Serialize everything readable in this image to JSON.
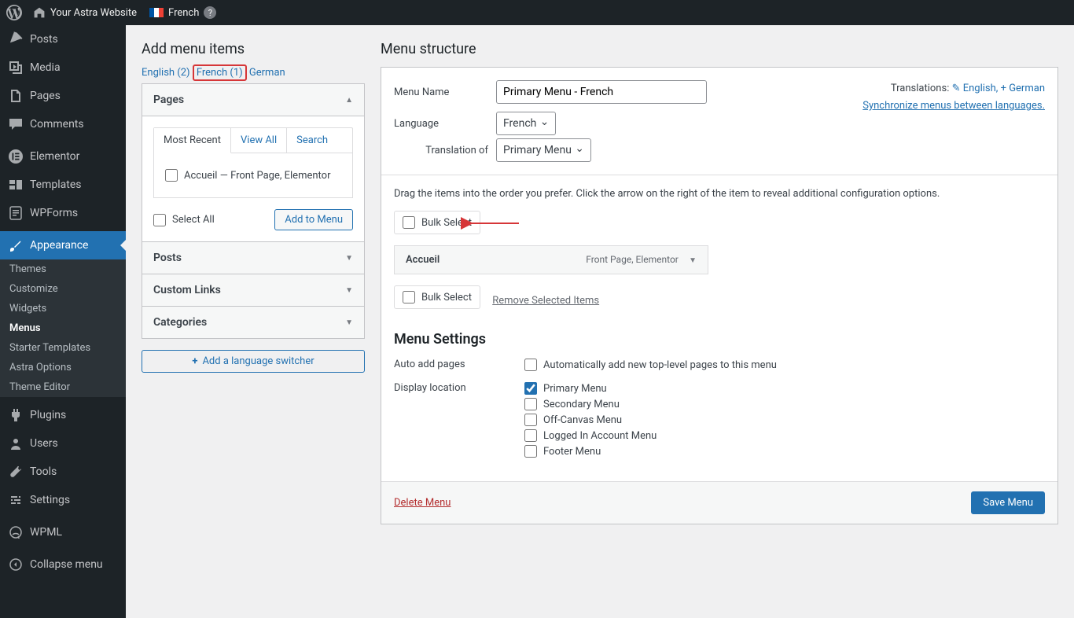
{
  "topbar": {
    "site": "Your Astra Website",
    "lang": "French"
  },
  "sidebar": {
    "items": [
      {
        "label": "Posts"
      },
      {
        "label": "Media"
      },
      {
        "label": "Pages"
      },
      {
        "label": "Comments"
      },
      {
        "label": "Elementor"
      },
      {
        "label": "Templates"
      },
      {
        "label": "WPForms"
      },
      {
        "label": "Appearance"
      },
      {
        "label": "Plugins"
      },
      {
        "label": "Users"
      },
      {
        "label": "Tools"
      },
      {
        "label": "Settings"
      },
      {
        "label": "WPML"
      }
    ],
    "sub": [
      {
        "label": "Themes"
      },
      {
        "label": "Customize"
      },
      {
        "label": "Widgets"
      },
      {
        "label": "Menus"
      },
      {
        "label": "Starter Templates"
      },
      {
        "label": "Astra Options"
      },
      {
        "label": "Theme Editor"
      }
    ],
    "collapse": "Collapse menu"
  },
  "left": {
    "heading": "Add menu items",
    "tabs": {
      "en": "English (2)",
      "fr": "French (1)",
      "de": "German"
    },
    "pages_title": "Pages",
    "inner_tabs": {
      "recent": "Most Recent",
      "all": "View All",
      "search": "Search"
    },
    "page_item": "Accueil — Front Page, Elementor",
    "select_all": "Select All",
    "add_to_menu": "Add to Menu",
    "posts": "Posts",
    "custom": "Custom Links",
    "categories": "Categories",
    "lang_switcher": "Add a language switcher"
  },
  "right": {
    "heading": "Menu structure",
    "name_label": "Menu Name",
    "name_value": "Primary Menu - French",
    "lang_label": "Language",
    "lang_value": "French",
    "trans_label": "Translation of",
    "trans_value": "Primary Menu",
    "translations": "Translations:",
    "en_link": "English,",
    "de_link": "German",
    "sync": "Synchronize menus between languages.",
    "drag_hint": "Drag the items into the order you prefer. Click the arrow on the right of the item to reveal additional configuration options.",
    "bulk": "Bulk Select",
    "item": {
      "title": "Accueil",
      "type": "Front Page, Elementor"
    },
    "remove": "Remove Selected Items",
    "settings_heading": "Menu Settings",
    "auto_label": "Auto add pages",
    "auto_opt": "Automatically add new top-level pages to this menu",
    "loc_label": "Display location",
    "locations": [
      "Primary Menu",
      "Secondary Menu",
      "Off-Canvas Menu",
      "Logged In Account Menu",
      "Footer Menu"
    ],
    "delete": "Delete Menu",
    "save": "Save Menu"
  }
}
